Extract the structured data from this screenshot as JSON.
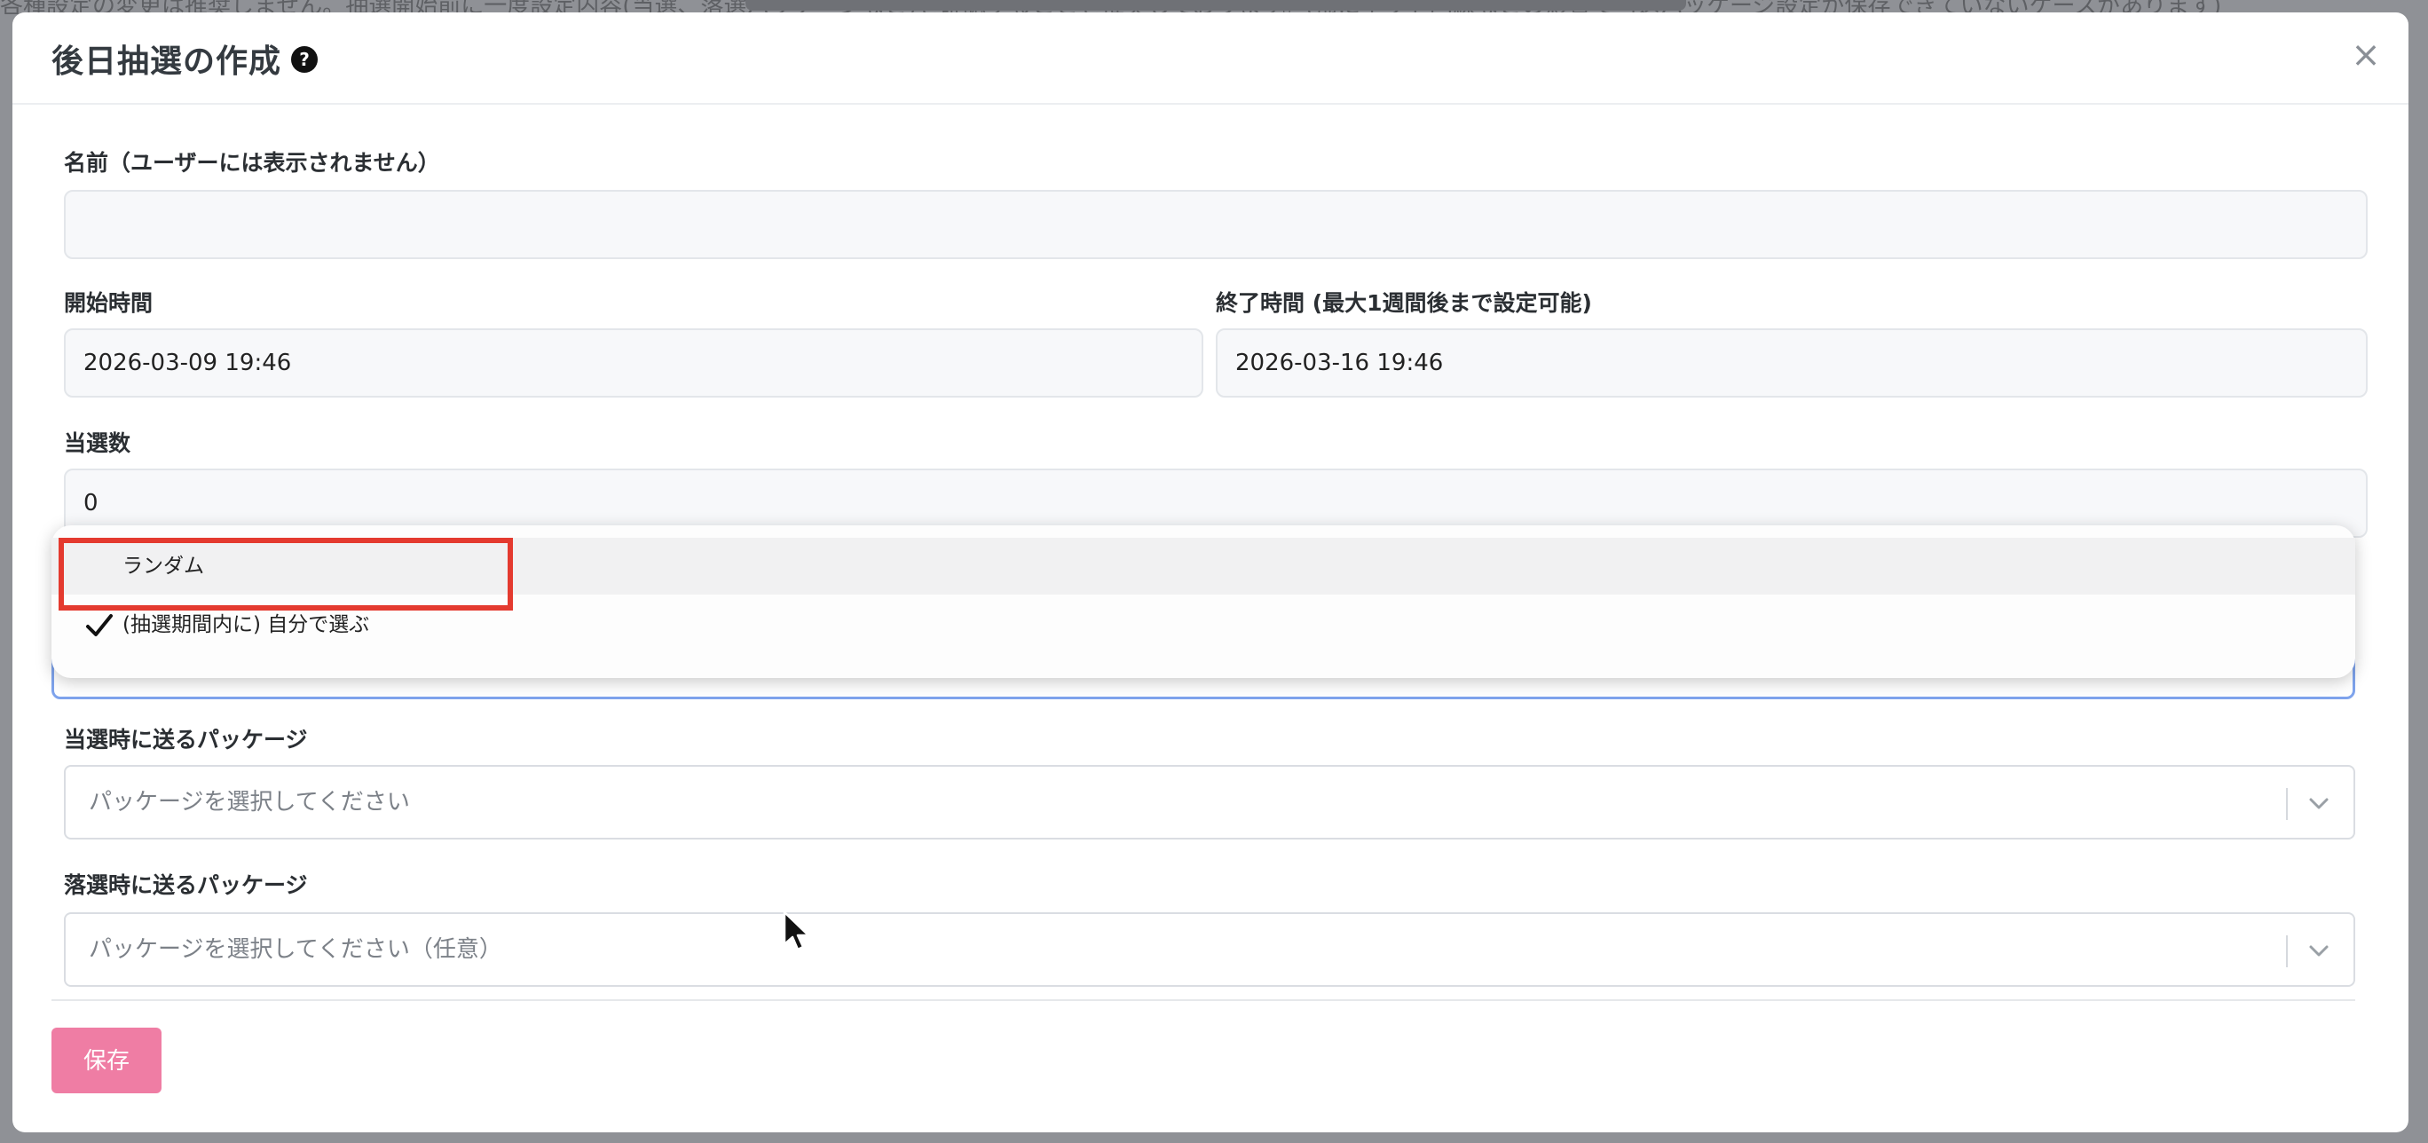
{
  "backdrop": {
    "text": "各種設定の変更は推奨しません。抽選開始前に一度設定内容(当選、落選パッケージなど)を確認することを推奨しております。(稀にネット回線などの影響で当選パッケージ設定が保存できていないケースがあります)"
  },
  "modal": {
    "title": "後日抽選の作成",
    "help_icon": "question-circle-icon",
    "close_icon": "close-icon",
    "close_label": "×"
  },
  "form": {
    "name_label": "名前（ユーザーには表示されません）",
    "name_value": "",
    "start_label": "開始時間",
    "start_value": "2026-03-09 19:46",
    "end_label": "終了時間 (最大1週間後まで設定可能)",
    "end_value": "2026-03-16 19:46",
    "winners_label": "当選数",
    "winners_value": "0",
    "method_dropdown": {
      "options": [
        "ランダム",
        "(抽選期間内に) 自分で選ぶ"
      ],
      "selected": "(抽選期間内に) 自分で選ぶ"
    },
    "win_package_label": "当選時に送るパッケージ",
    "win_package_placeholder": "パッケージを選択してください",
    "lose_package_label": "落選時に送るパッケージ",
    "lose_package_placeholder": "パッケージを選択してください（任意）",
    "save_label": "保存"
  },
  "colors": {
    "accent_save": "#ef7da4",
    "highlight_box": "#e43a2f",
    "focus_border": "#7ea3ec"
  }
}
